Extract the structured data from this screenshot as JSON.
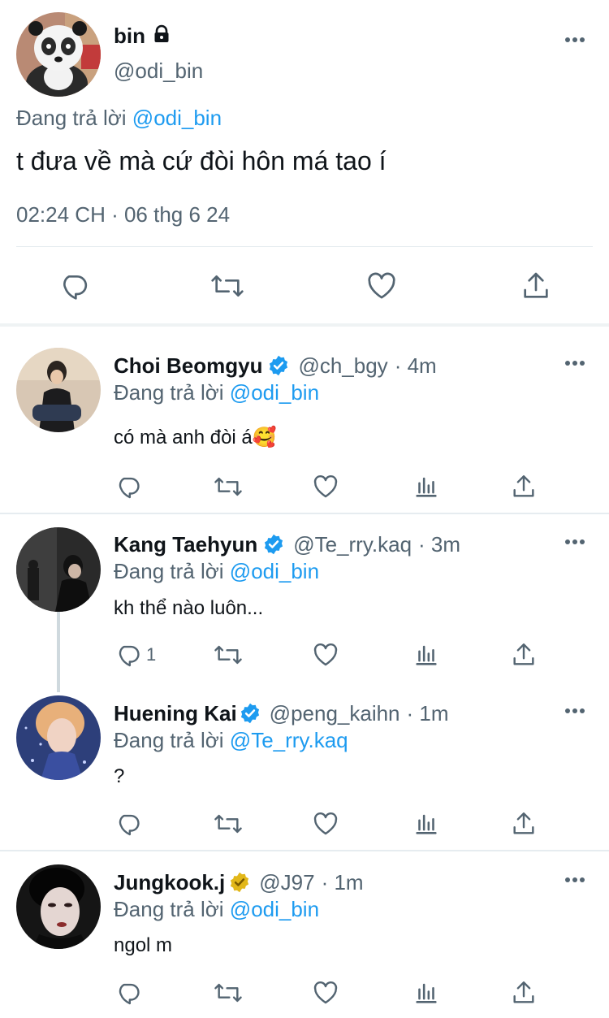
{
  "main_tweet": {
    "display_name": "bin",
    "lock_icon": "lock-icon",
    "handle": "@odi_bin",
    "reply_prefix": "Đang trả lời",
    "reply_mention": "@odi_bin",
    "text": "t đưa về mà cứ đòi hôn má tao í",
    "timestamp": "02:24 CH · 06 thg 6 24",
    "actions": [
      "reply-icon",
      "retweet-icon",
      "like-icon",
      "share-icon"
    ]
  },
  "replies": [
    {
      "display_name": "Choi Beomgyu",
      "verified": "blue",
      "handle": "@ch_bgy",
      "time": "· 4m",
      "reply_prefix": "Đang trả lời",
      "reply_mention": "@odi_bin",
      "text": "có mà anh đòi á🥰",
      "reply_count": ""
    },
    {
      "display_name": "Kang Taehyun",
      "verified": "blue",
      "handle": "@Te_rry.kaq",
      "time": "· 3m",
      "reply_prefix": "Đang trả lời",
      "reply_mention": "@odi_bin",
      "text": "kh thể nào luôn...",
      "reply_count": "1"
    },
    {
      "display_name": "Huening Kai",
      "verified": "blue",
      "handle": "@peng_kaihn",
      "time": "· 1m",
      "reply_prefix": "Đang trả lời",
      "reply_mention": "@Te_rry.kaq",
      "text": "?",
      "reply_count": ""
    },
    {
      "display_name": "Jungkook.j",
      "verified": "gold",
      "handle": "@J97",
      "time": "· 1m",
      "reply_prefix": "Đang trả lời",
      "reply_mention": "@odi_bin",
      "text": "ngol m",
      "reply_count": ""
    }
  ],
  "colors": {
    "accent": "#1d9bf0",
    "gold_badge": "#e2b719",
    "secondary_text": "#536471",
    "icon": "#536471"
  }
}
